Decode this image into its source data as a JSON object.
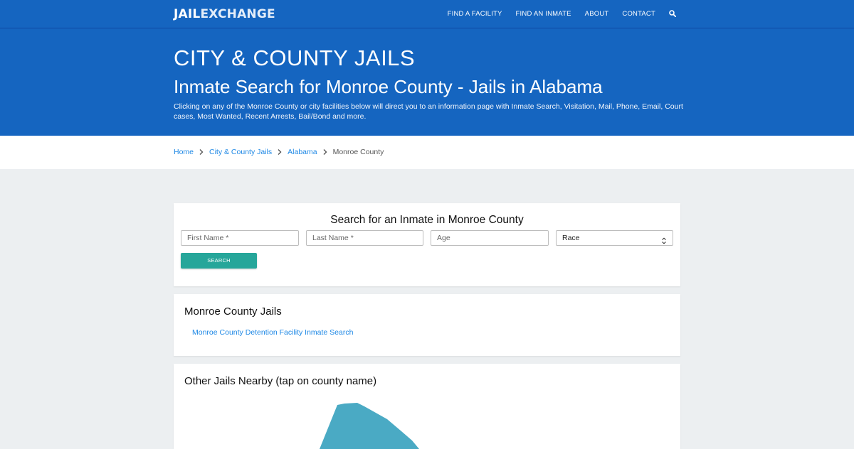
{
  "brand": {
    "part1": "JAIL",
    "part2": "EXCHANGE"
  },
  "nav": {
    "items": [
      "FIND A FACILITY",
      "FIND AN INMATE",
      "ABOUT",
      "CONTACT"
    ],
    "search_icon": "search-icon"
  },
  "hero": {
    "kicker": "CITY & COUNTY JAILS",
    "title": "Inmate Search for Monroe County - Jails in Alabama",
    "description": "Clicking on any of the Monroe County or city facilities below will direct you to an information page with Inmate Search, Visitation, Mail, Phone, Email, Court cases, Most Wanted, Recent Arrests, Bail/Bond and more."
  },
  "breadcrumb": {
    "items": [
      "Home",
      "City & County Jails",
      "Alabama"
    ],
    "current": "Monroe County"
  },
  "search": {
    "title": "Search for an Inmate in Monroe County",
    "first_name_placeholder": "First Name *",
    "last_name_placeholder": "Last Name *",
    "age_placeholder": "Age",
    "race_value": "Race",
    "button_label": "SEARCH"
  },
  "jails": {
    "title": "Monroe County Jails",
    "links": [
      "Monroe County Detention Facility Inmate Search"
    ]
  },
  "nearby": {
    "title": "Other Jails Nearby (tap on county name)",
    "map_color": "#4aaac4"
  },
  "colors": {
    "primary": "#1565c0",
    "accent": "#26a69a",
    "link": "#1e88e5"
  }
}
